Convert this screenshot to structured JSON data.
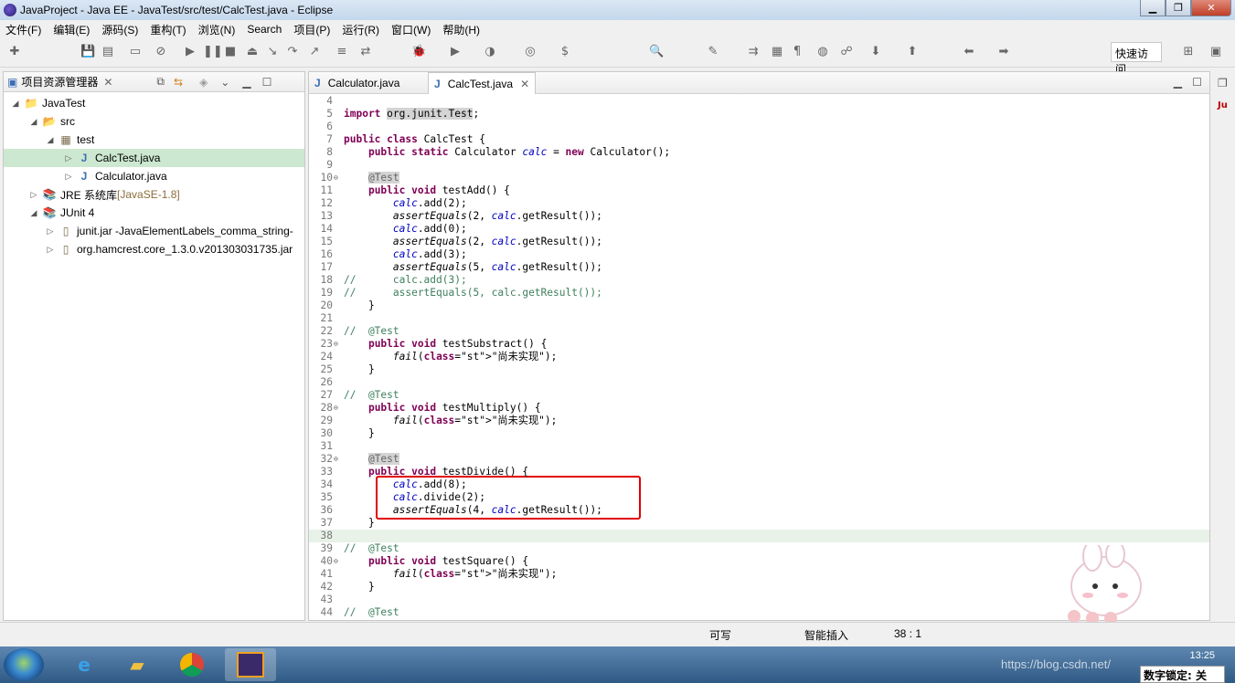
{
  "window": {
    "title": "JavaProject - Java EE - JavaTest/src/test/CalcTest.java - Eclipse",
    "min": "0",
    "max": "1",
    "close": "x"
  },
  "menu": [
    "文件(F)",
    "编辑(E)",
    "源码(S)",
    "重构(T)",
    "浏览(N)",
    "Search",
    "项目(P)",
    "运行(R)",
    "窗口(W)",
    "帮助(H)"
  ],
  "quick_access": "快速访问",
  "explorer": {
    "title": "项目资源管理器",
    "rows": [
      {
        "tw": "◢",
        "icon": "project-folder-icon",
        "glyph": "📁",
        "label": "JavaTest",
        "extra": ""
      },
      {
        "tw": "◢",
        "icon": "source-folder-icon",
        "glyph": "📂",
        "label": "src",
        "extra": ""
      },
      {
        "tw": "◢",
        "icon": "package-icon",
        "glyph": "▦",
        "label": "test",
        "extra": ""
      },
      {
        "tw": "▷",
        "icon": "java-file-icon",
        "glyph": "J",
        "label": "CalcTest.java",
        "extra": ""
      },
      {
        "tw": "▷",
        "icon": "java-file-icon",
        "glyph": "J",
        "label": "Calculator.java",
        "extra": ""
      },
      {
        "tw": "▷",
        "icon": "library-icon",
        "glyph": "📚",
        "label": "JRE 系统库 ",
        "extra": "[JavaSE-1.8]"
      },
      {
        "tw": "◢",
        "icon": "library-icon",
        "glyph": "📚",
        "label": "JUnit 4",
        "extra": ""
      },
      {
        "tw": "▷",
        "icon": "jar-icon",
        "glyph": "▯",
        "label": "junit.jar -JavaElementLabels_comma_string-",
        "extra": ""
      },
      {
        "tw": "▷",
        "icon": "jar-icon",
        "glyph": "▯",
        "label": "org.hamcrest.core_1.3.0.v201303031735.jar",
        "extra": ""
      }
    ]
  },
  "tabs": [
    {
      "label": "Calculator.java"
    },
    {
      "label": "CalcTest.java"
    }
  ],
  "code": [
    {
      "n": "4",
      "t": ""
    },
    {
      "n": "5",
      "t": "import org.junit.Test;"
    },
    {
      "n": "6",
      "t": ""
    },
    {
      "n": "7",
      "t": "public class CalcTest {"
    },
    {
      "n": "8",
      "t": "    public static Calculator calc = new Calculator();"
    },
    {
      "n": "9",
      "t": ""
    },
    {
      "n": "10",
      "t": "    @Test"
    },
    {
      "n": "11",
      "t": "    public void testAdd() {"
    },
    {
      "n": "12",
      "t": "        calc.add(2);"
    },
    {
      "n": "13",
      "t": "        assertEquals(2, calc.getResult());"
    },
    {
      "n": "14",
      "t": "        calc.add(0);"
    },
    {
      "n": "15",
      "t": "        assertEquals(2, calc.getResult());"
    },
    {
      "n": "16",
      "t": "        calc.add(3);"
    },
    {
      "n": "17",
      "t": "        assertEquals(5, calc.getResult());"
    },
    {
      "n": "18",
      "t": "//      calc.add(3);"
    },
    {
      "n": "19",
      "t": "//      assertEquals(5, calc.getResult());"
    },
    {
      "n": "20",
      "t": "    }"
    },
    {
      "n": "21",
      "t": ""
    },
    {
      "n": "22",
      "t": "//  @Test"
    },
    {
      "n": "23",
      "t": "    public void testSubstract() {"
    },
    {
      "n": "24",
      "t": "        fail(\"尚未实现\");"
    },
    {
      "n": "25",
      "t": "    }"
    },
    {
      "n": "26",
      "t": ""
    },
    {
      "n": "27",
      "t": "//  @Test"
    },
    {
      "n": "28",
      "t": "    public void testMultiply() {"
    },
    {
      "n": "29",
      "t": "        fail(\"尚未实现\");"
    },
    {
      "n": "30",
      "t": "    }"
    },
    {
      "n": "31",
      "t": ""
    },
    {
      "n": "32",
      "t": "    @Test"
    },
    {
      "n": "33",
      "t": "    public void testDivide() {"
    },
    {
      "n": "34",
      "t": "        calc.add(8);"
    },
    {
      "n": "35",
      "t": "        calc.divide(2);"
    },
    {
      "n": "36",
      "t": "        assertEquals(4, calc.getResult());"
    },
    {
      "n": "37",
      "t": "    }"
    },
    {
      "n": "38",
      "t": ""
    },
    {
      "n": "39",
      "t": "//  @Test"
    },
    {
      "n": "40",
      "t": "    public void testSquare() {"
    },
    {
      "n": "41",
      "t": "        fail(\"尚未实现\");"
    },
    {
      "n": "42",
      "t": "    }"
    },
    {
      "n": "43",
      "t": ""
    },
    {
      "n": "44",
      "t": "//  @Test"
    }
  ],
  "status": {
    "writable": "可写",
    "insert_mode": "智能插入",
    "position": "38 : 1"
  },
  "taskbar": {
    "clock": "13:25",
    "lock": "数字锁定: 关",
    "watermark": "https://blog.csdn.net/"
  }
}
